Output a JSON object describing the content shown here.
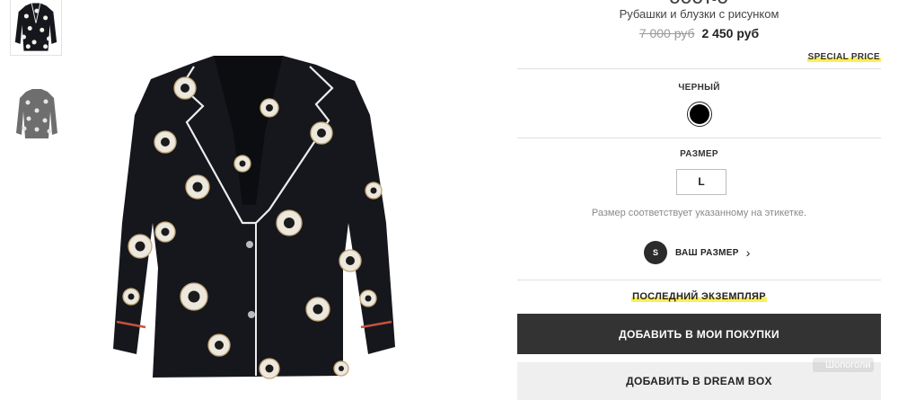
{
  "product": {
    "brand_partial": "OOOT-O",
    "category": "Рубашки и блузки с рисунком",
    "old_price": "7 000 руб",
    "new_price": "2 450 руб",
    "special_price_badge": "SPECIAL PRICE"
  },
  "color": {
    "label": "ЧЕРНЫЙ",
    "swatch_hex": "#000000"
  },
  "size": {
    "label": "РАЗМЕР",
    "selected": "L",
    "note": "Размер соответствует указанному на этикетке.",
    "your_size_badge": "S",
    "your_size_label": "ВАШ РАЗМЕР",
    "chevron_glyph": "›"
  },
  "stock": {
    "last_item": "ПОСЛЕДНИЙ ЭКЗЕМПЛЯР"
  },
  "actions": {
    "add_to_cart": "ДОБАВИТЬ В МОИ ПОКУПКИ",
    "add_to_dreambox": "ДОБАВИТЬ В DREAM BOX"
  },
  "watermark": "Шопоголи",
  "colors": {
    "primary_button": "#333333",
    "secondary_button": "#efefef",
    "highlight": "#f9ef5a",
    "garment": "#16171d"
  }
}
